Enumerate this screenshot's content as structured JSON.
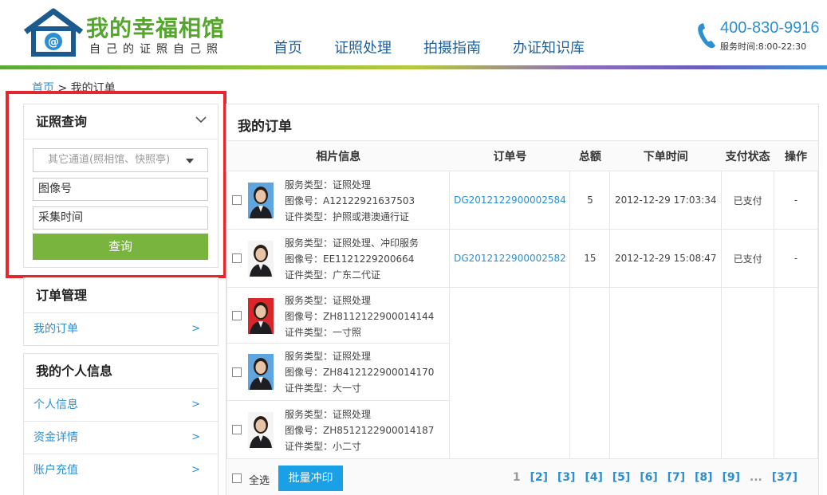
{
  "header": {
    "logo_title": "我的幸福相馆",
    "logo_sub": "自己的证照自己照",
    "nav": [
      "首页",
      "证照处理",
      "拍摄指南",
      "办证知识库"
    ],
    "phone": "400-830-9916",
    "service_time": "服务时间:8:00-22:30"
  },
  "breadcrumb": {
    "home": "首页",
    "sep": ">",
    "current": "我的订单"
  },
  "query": {
    "title": "证照查询",
    "channel_select": "其它通道(照相馆、快照亭)",
    "image_no_field": "图像号",
    "time_field": "采集时间",
    "button": "查询"
  },
  "order_mgmt": {
    "title": "订单管理",
    "items": [
      {
        "label": "我的订单",
        "arrow": ">"
      }
    ]
  },
  "personal": {
    "title": "我的个人信息",
    "items": [
      {
        "label": "个人信息",
        "arrow": ">"
      },
      {
        "label": "资金详情",
        "arrow": ">"
      },
      {
        "label": "账户充值",
        "arrow": ">"
      }
    ]
  },
  "main": {
    "title": "我的订单",
    "columns": [
      "相片信息",
      "订单号",
      "总额",
      "下单时间",
      "支付状态",
      "操作"
    ],
    "rows": [
      {
        "service": "服务类型：证照处理",
        "image_no": "图像号：A12122921637503",
        "cert": "证件类型：护照或港澳通行证",
        "order_no": "DG2012122900002584",
        "total": "5",
        "time": "2012-12-29 17:03:34",
        "status": "已支付",
        "op": "-"
      },
      {
        "service": "服务类型：证照处理、冲印服务",
        "image_no": "图像号：EE1121229200664",
        "cert": "证件类型：广东二代证",
        "order_no": "DG2012122900002582",
        "total": "15",
        "time": "2012-12-29 15:08:47",
        "status": "已支付",
        "op": "-"
      },
      {
        "service": "服务类型：证照处理",
        "image_no": "图像号：ZH8112122900014144",
        "cert": "证件类型：一寸照"
      },
      {
        "service": "服务类型：证照处理",
        "image_no": "图像号：ZH8412122900014170",
        "cert": "证件类型：大一寸"
      },
      {
        "service": "服务类型：证照处理",
        "image_no": "图像号：ZH8512122900014187",
        "cert": "证件类型：小二寸"
      }
    ],
    "select_all": "全选",
    "batch_button": "批量冲印",
    "pager": [
      "1",
      "[2]",
      "[3]",
      "[4]",
      "[5]",
      "[6]",
      "[7]",
      "[8]",
      "[9]",
      "...",
      "[37]"
    ]
  },
  "colors": {
    "brand_green": "#55a62d",
    "link_blue": "#2c8fd1",
    "button_green": "#78b43e",
    "button_blue": "#1aa0e6",
    "highlight_red": "#e4262d"
  }
}
